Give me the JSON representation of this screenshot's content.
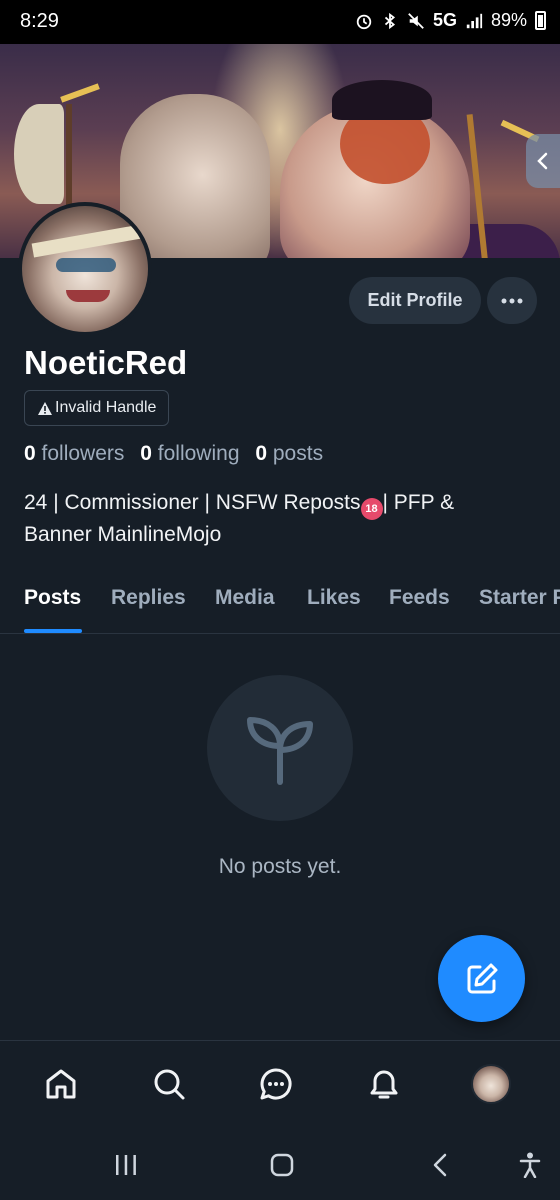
{
  "status_bar": {
    "time": "8:29",
    "network": "5G",
    "battery": "89%"
  },
  "profile": {
    "name": "NoeticRed",
    "handle_badge": "Invalid Handle",
    "edit_button": "Edit Profile",
    "stats": {
      "followers_count": "0",
      "followers_label": "followers",
      "following_count": "0",
      "following_label": "following",
      "posts_count": "0",
      "posts_label": "posts"
    },
    "bio_line1_prefix": "24 | Commissioner | NSFW Reposts",
    "bio_badge": "18",
    "bio_line1_suffix": "| PFP &",
    "bio_line2": "Banner MainlineMojo"
  },
  "tabs": [
    {
      "label": "Posts",
      "active": true
    },
    {
      "label": "Replies"
    },
    {
      "label": "Media"
    },
    {
      "label": "Likes"
    },
    {
      "label": "Feeds"
    },
    {
      "label": "Starter Packs"
    }
  ],
  "empty_state": {
    "message": "No posts yet.",
    "icon": "sprout-icon"
  },
  "fab": {
    "icon": "compose-icon"
  },
  "bottom_nav": [
    "home-icon",
    "search-icon",
    "chat-icon",
    "bell-icon",
    "profile-avatar"
  ],
  "system_nav": [
    "recents-icon",
    "home-circle-icon",
    "back-icon",
    "accessibility-icon"
  ],
  "colors": {
    "accent": "#1f8bff",
    "background": "#161e27",
    "button_bg": "#27323e"
  }
}
